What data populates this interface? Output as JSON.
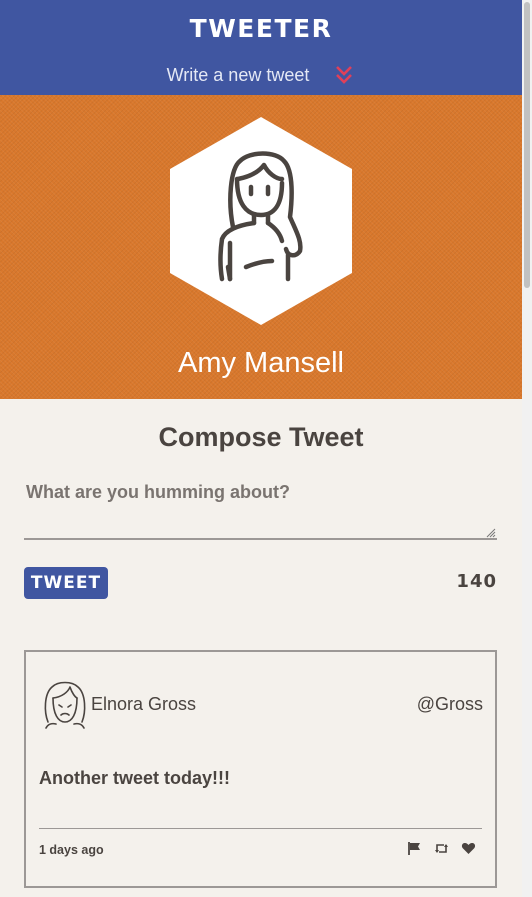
{
  "nav": {
    "brand": "TWEETER",
    "compose_toggle_label": "Write a new tweet",
    "toggle_icon": "double-chevron-down-icon"
  },
  "profile": {
    "name": "Amy Mansell",
    "avatar_icon": "woman-avatar-icon"
  },
  "compose": {
    "title": "Compose Tweet",
    "placeholder": "What are you humming about?",
    "value": "",
    "button_label": "TWEET",
    "counter": "140"
  },
  "tweets": [
    {
      "author": "Elnora Gross",
      "handle": "@Gross",
      "avatar_icon": "girl-avatar-icon",
      "content": "Another tweet today!!!",
      "time": "1 days ago",
      "actions": [
        "flag-icon",
        "retweet-icon",
        "heart-icon"
      ]
    }
  ],
  "colors": {
    "nav_bg": "#4056a1",
    "header_bg": "#d9782c",
    "page_bg": "#f4f1ec",
    "text": "#4a4440",
    "chevron": "#e0405a"
  }
}
